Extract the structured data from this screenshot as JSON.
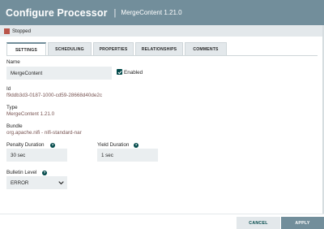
{
  "dialog": {
    "title": "Configure Processor",
    "separator": "|",
    "subtitle": "MergeContent 1.21.0"
  },
  "status": {
    "text": "Stopped",
    "icon": "stop-icon",
    "color": "#ba554a"
  },
  "tabs": [
    {
      "label": "SETTINGS",
      "active": true
    },
    {
      "label": "SCHEDULING",
      "active": false
    },
    {
      "label": "PROPERTIES",
      "active": false
    },
    {
      "label": "RELATIONSHIPS",
      "active": false
    },
    {
      "label": "COMMENTS",
      "active": false
    }
  ],
  "settings": {
    "name_label": "Name",
    "name_value": "MergeContent",
    "enabled_label": "Enabled",
    "enabled": true,
    "id_label": "Id",
    "id_value": "f9ddb3d3-0187-1000-cd59-28668d40de2c",
    "type_label": "Type",
    "type_value": "MergeContent 1.21.0",
    "bundle_label": "Bundle",
    "bundle_value": "org.apache.nifi - nifi-standard-nar",
    "penalty_label": "Penalty Duration",
    "penalty_value": "30 sec",
    "yield_label": "Yield Duration",
    "yield_value": "1 sec",
    "bulletin_label": "Bulletin Level",
    "bulletin_value": "ERROR"
  },
  "footer": {
    "cancel_label": "CANCEL",
    "apply_label": "APPLY"
  },
  "colors": {
    "header": "#728e9b",
    "accent": "#004849",
    "value_text": "#775351"
  }
}
